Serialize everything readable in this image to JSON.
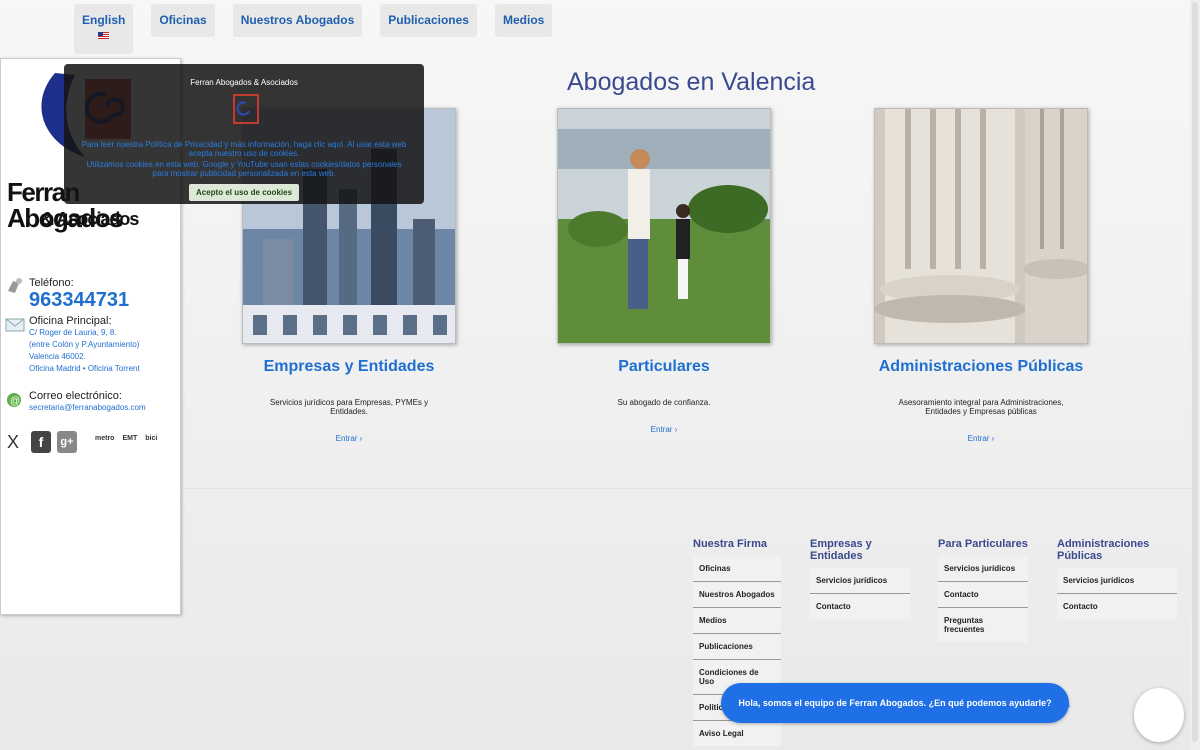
{
  "nav": {
    "items": [
      {
        "label": "English",
        "flag": "uk-flag-icon"
      },
      {
        "label": "Oficinas"
      },
      {
        "label": "Nuestros Abogados"
      },
      {
        "label": "Publicaciones"
      },
      {
        "label": "Medios"
      }
    ]
  },
  "sidebar": {
    "logo_line1": "Ferran Abogados",
    "logo_line2": "& Asociados",
    "phone_label": "Teléfono:",
    "phone": "963344731",
    "office_label": "Oficina Principal:",
    "address_line1": "C/ Roger de Lauria, 9, 8.",
    "address_line2": "(entre Colón y P.Ayuntamiento)",
    "address_line3": "Valencia 46002.",
    "office_links": "Oficina Madrid  •  Oficina Torrent",
    "email_label": "Correo electrónico:",
    "email": "secretaria@ferranabogados.com",
    "social": [
      "X",
      "f",
      "g+"
    ],
    "partners": [
      "metro",
      "EMT",
      "bici"
    ]
  },
  "cookie": {
    "title": "Ferran Abogados & Asociados",
    "text1": " Para leer nuestra Política de Privacidad y más información, haga clic aquí. Al usar esta web acepta nuestro uso de cookies.",
    "text2": " Utilizamos cookies en esta web. Google y YouTube usan estas cookies/datos personales para mostrar publicidad personalizada en esta web.",
    "button": "Acepto el uso de cookies"
  },
  "main": {
    "title": "Abogados en Valencia",
    "cards": [
      {
        "title": "Empresas y Entidades",
        "desc": "Servicios jurídicos para Empresas, PYMEs y Entidades.",
        "link": "Entrar  ›"
      },
      {
        "title": "Particulares",
        "desc": "Su abogado de confianza.",
        "link": "Entrar  ›"
      },
      {
        "title": "Administraciones Públicas",
        "desc": "Asesoramiento integral para Administraciones, Entidades y Empresas públicas",
        "link": "Entrar  ›"
      }
    ]
  },
  "footer": {
    "cols": [
      {
        "head": "Nuestra Firma",
        "items": [
          "Oficinas",
          "Nuestros Abogados",
          "Medios",
          "Publicaciones",
          "Condiciones de Uso",
          "Politica",
          "Aviso Legal"
        ]
      },
      {
        "head": "Empresas y Entidades",
        "items": [
          "Servicios jurídicos",
          "Contacto"
        ]
      },
      {
        "head": "Para Particulares",
        "items": [
          "Servicios jurídicos",
          "Contacto",
          "Preguntas frecuentes"
        ]
      },
      {
        "head": "Administraciones Públicas",
        "items": [
          "Servicios jurídicos",
          "Contacto"
        ]
      }
    ]
  },
  "chat": {
    "message": "Hola, somos el equipo de Ferran Abogados. ¿En qué podemos ayudarle?"
  },
  "colors": {
    "accent": "#1f6fd0",
    "title": "#3a4a8e",
    "chat": "#1f6fe6"
  }
}
